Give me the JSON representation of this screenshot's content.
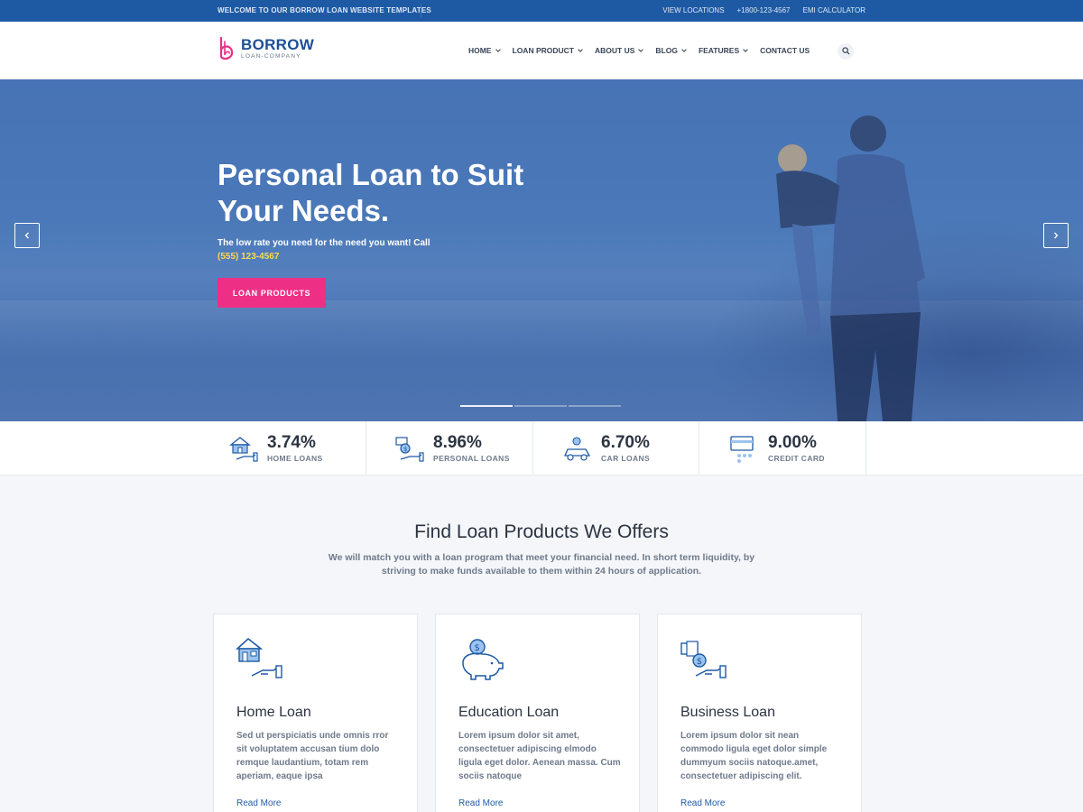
{
  "topbar": {
    "welcome": "WELCOME TO OUR BORROW LOAN WEBSITE TEMPLATES",
    "links": [
      "VIEW LOCATIONS",
      "+1800-123-4567",
      "EMI CALCULATOR"
    ]
  },
  "brand": {
    "name": "BORROW",
    "tagline": "LOAN-COMPANY",
    "accent": "#e82f87",
    "primary": "#1e4f94"
  },
  "nav": {
    "items": [
      {
        "label": "HOME",
        "dropdown": true
      },
      {
        "label": "LOAN PRODUCT",
        "dropdown": true
      },
      {
        "label": "ABOUT US",
        "dropdown": true
      },
      {
        "label": "BLOG",
        "dropdown": true
      },
      {
        "label": "FEATURES",
        "dropdown": true
      },
      {
        "label": "CONTACT US",
        "dropdown": false
      }
    ],
    "search_icon": "search-icon"
  },
  "hero": {
    "title": "Personal Loan to Suit Your Needs.",
    "subtitle": "The low rate you need for the need you want! Call",
    "phone": "(555) 123-4567",
    "button": "LOAN PRODUCTS",
    "button_color": "#ee2f86",
    "slides": 3,
    "active_slide": 1
  },
  "rates": [
    {
      "value": "3.74%",
      "label": "HOME LOANS",
      "icon": "home-loan-icon"
    },
    {
      "value": "8.96%",
      "label": "PERSONAL LOANS",
      "icon": "personal-loan-icon"
    },
    {
      "value": "6.70%",
      "label": "CAR LOANS",
      "icon": "car-loan-icon"
    },
    {
      "value": "9.00%",
      "label": "CREDIT CARD",
      "icon": "credit-card-icon"
    }
  ],
  "section": {
    "title": "Find Loan Products We Offers",
    "description": "We will match you with a loan program that meet your financial need. In short term liquidity, by striving to make funds available to them within 24 hours of application."
  },
  "cards": [
    {
      "title": "Home Loan",
      "text": "Sed ut perspiciatis unde omnis rror sit voluptatem accusan tium dolo remque laudantium, totam rem aperiam, eaque ipsa",
      "link": "Read More",
      "icon": "house-hand-icon"
    },
    {
      "title": "Education Loan",
      "text": "Lorem ipsum dolor sit amet, consectetuer adipiscing elmodo ligula eget dolor. Aenean massa. Cum sociis natoque",
      "link": "Read More",
      "icon": "piggy-bank-icon"
    },
    {
      "title": "Business Loan",
      "text": "Lorem ipsum dolor sit nean commodo ligula eget dolor simple dummyum sociis natoque.amet, consectetuer adipiscing elit.",
      "link": "Read More",
      "icon": "money-hand-icon"
    }
  ]
}
